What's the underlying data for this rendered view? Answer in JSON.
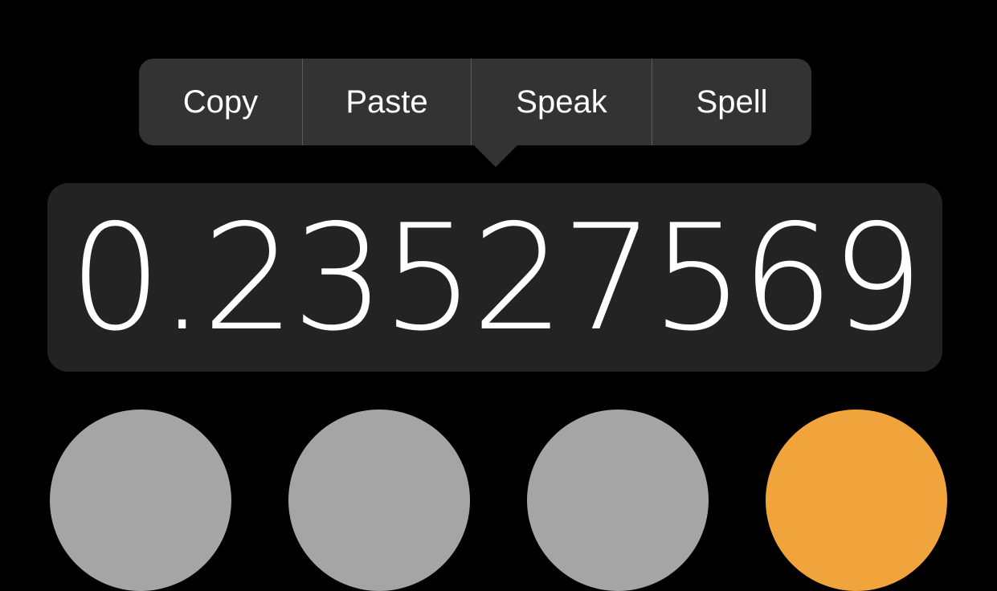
{
  "context_menu": {
    "items": [
      {
        "label": "Copy"
      },
      {
        "label": "Paste"
      },
      {
        "label": "Speak"
      },
      {
        "label": "Spell"
      }
    ]
  },
  "display": {
    "value": "0.23527569"
  },
  "keys": [
    {
      "role": "function-key",
      "color": "#a5a5a5"
    },
    {
      "role": "function-key",
      "color": "#a5a5a5"
    },
    {
      "role": "function-key",
      "color": "#a5a5a5"
    },
    {
      "role": "operator-key",
      "color": "#f1a33c"
    }
  ]
}
